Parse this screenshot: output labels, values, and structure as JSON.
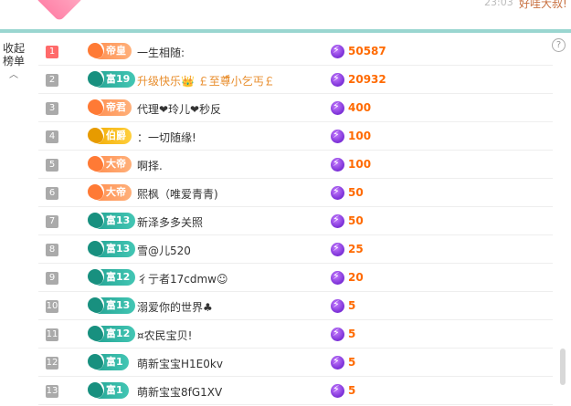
{
  "header": {
    "time": "23:03",
    "message": "好哇大叔!"
  },
  "sidebar": {
    "collapse_label_line1": "收起",
    "collapse_label_line2": "榜单",
    "chevron": "︿"
  },
  "help": "?",
  "rows": [
    {
      "rank": "1",
      "badge": "帝皇",
      "badge_style": "orange",
      "name": "一生相随:",
      "name_special": false,
      "amount": "50587"
    },
    {
      "rank": "2",
      "badge": "富19",
      "badge_style": "teal",
      "name": "升级快乐👑 ￡至尊็小乞丐￡",
      "name_special": true,
      "amount": "20932"
    },
    {
      "rank": "3",
      "badge": "帝君",
      "badge_style": "orange",
      "name": "代理❤玲儿❤秒反",
      "name_special": false,
      "amount": "400"
    },
    {
      "rank": "4",
      "badge": "伯爵",
      "badge_style": "gold",
      "name": "：一切随缘!",
      "name_special": false,
      "amount": "100"
    },
    {
      "rank": "5",
      "badge": "大帝",
      "badge_style": "orange",
      "name": "啊择.",
      "name_special": false,
      "amount": "100"
    },
    {
      "rank": "6",
      "badge": "大帝",
      "badge_style": "orange",
      "name": "熙枫（唯爱青青)",
      "name_special": false,
      "amount": "50"
    },
    {
      "rank": "7",
      "badge": "富13",
      "badge_style": "teal",
      "name": "新泽多多关照",
      "name_special": false,
      "amount": "50"
    },
    {
      "rank": "8",
      "badge": "富13",
      "badge_style": "teal",
      "name": "雪@儿520",
      "name_special": false,
      "amount": "25"
    },
    {
      "rank": "9",
      "badge": "富12",
      "badge_style": "teal",
      "name": "彳亍者17cdmw☺",
      "name_special": false,
      "amount": "20"
    },
    {
      "rank": "10",
      "badge": "富13",
      "badge_style": "teal",
      "name": "溺爱你的世界♣",
      "name_special": false,
      "amount": "5"
    },
    {
      "rank": "11",
      "badge": "富12",
      "badge_style": "teal",
      "name": "¤农民宝贝!",
      "name_special": false,
      "amount": "5"
    },
    {
      "rank": "12",
      "badge": "富1",
      "badge_style": "teal",
      "name": "萌新宝宝H1E0kv",
      "name_special": false,
      "amount": "5"
    },
    {
      "rank": "13",
      "badge": "富1",
      "badge_style": "teal",
      "name": "萌新宝宝8fG1XV",
      "name_special": false,
      "amount": "5"
    }
  ]
}
